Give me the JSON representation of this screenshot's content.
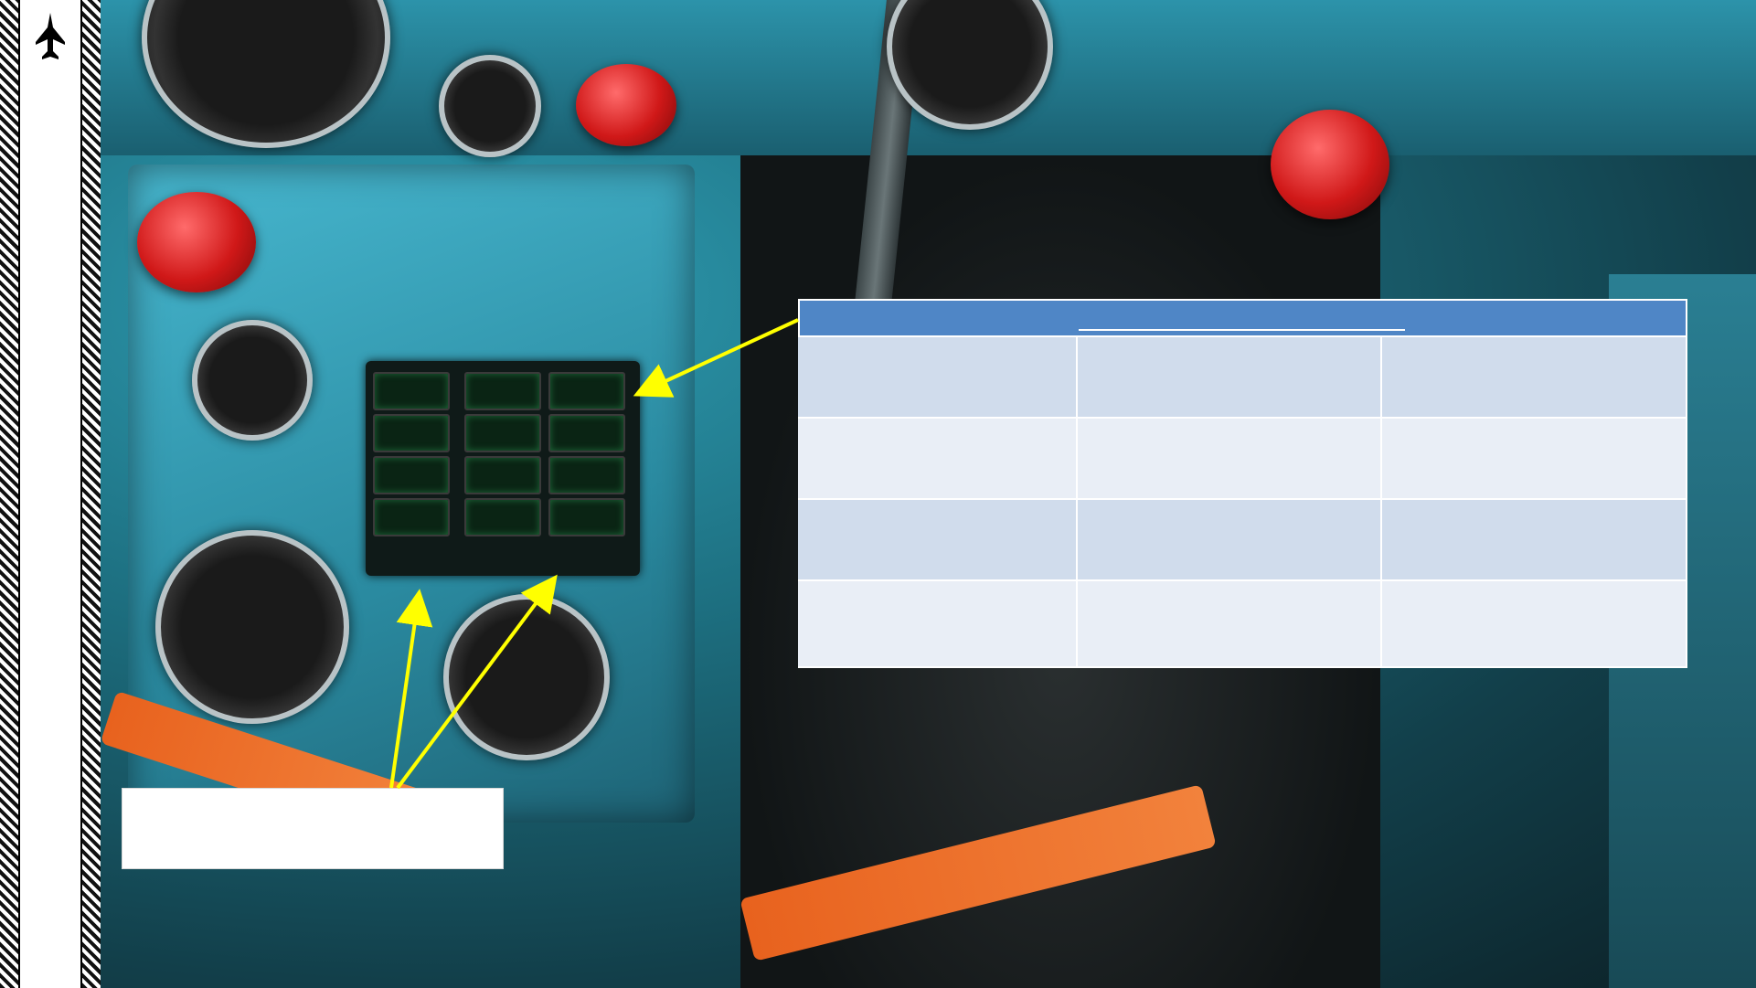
{
  "colors": {
    "table_header": "#4f86c6",
    "row_dark": "#d0dcec",
    "row_light": "#e9eef6",
    "arrow": "#ffff00",
    "callout_background": "#ffffff"
  },
  "icons": {
    "sidebar": "jet-aircraft-icon"
  },
  "table": {
    "header": "",
    "rows": [
      [
        "",
        "",
        ""
      ],
      [
        "",
        "",
        ""
      ],
      [
        "",
        "",
        ""
      ],
      [
        "",
        "",
        ""
      ]
    ]
  },
  "callout": {
    "text": ""
  }
}
